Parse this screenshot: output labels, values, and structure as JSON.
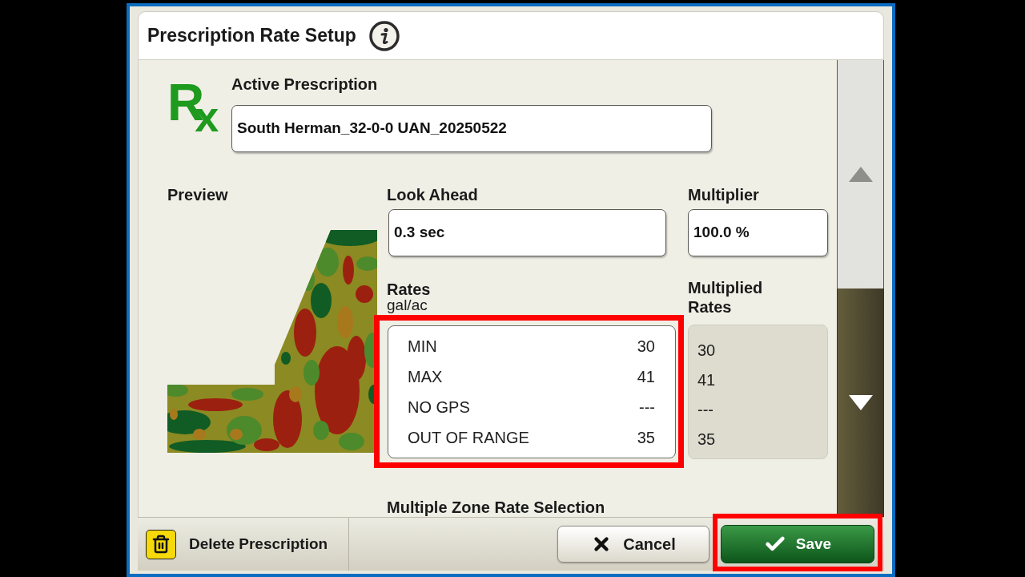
{
  "window": {
    "title": "Prescription Rate Setup"
  },
  "active_prescription": {
    "symbol": "R$_{x}$",
    "label": "Active Prescription",
    "value": "South Herman_32-0-0 UAN_20250522"
  },
  "preview": {
    "label": "Preview"
  },
  "look_ahead": {
    "label": "Look Ahead",
    "value": "0.3 sec"
  },
  "multiplier": {
    "label": "Multiplier",
    "value": "100.0 %"
  },
  "rates": {
    "label": "Rates",
    "unit": "gal/ac",
    "highlighted": true,
    "rows": [
      {
        "name": "MIN",
        "value": "30"
      },
      {
        "name": "MAX",
        "value": "41"
      },
      {
        "name": "NO GPS",
        "value": "---"
      },
      {
        "name": "OUT OF RANGE",
        "value": "35"
      }
    ]
  },
  "multiplied_rates": {
    "label": "Multiplied Rates",
    "values": [
      "30",
      "41",
      "---",
      "35"
    ]
  },
  "next_section": {
    "label": "Multiple Zone Rate Selection"
  },
  "scroll_buttons": [
    {
      "kind": "up",
      "disabled": true
    },
    {
      "kind": "down",
      "disabled": false
    }
  ],
  "footer": {
    "delete": {
      "label": "Delete Prescription"
    },
    "cancel": {
      "label": "Cancel"
    },
    "save": {
      "label": "Save",
      "highlighted": true
    }
  }
}
